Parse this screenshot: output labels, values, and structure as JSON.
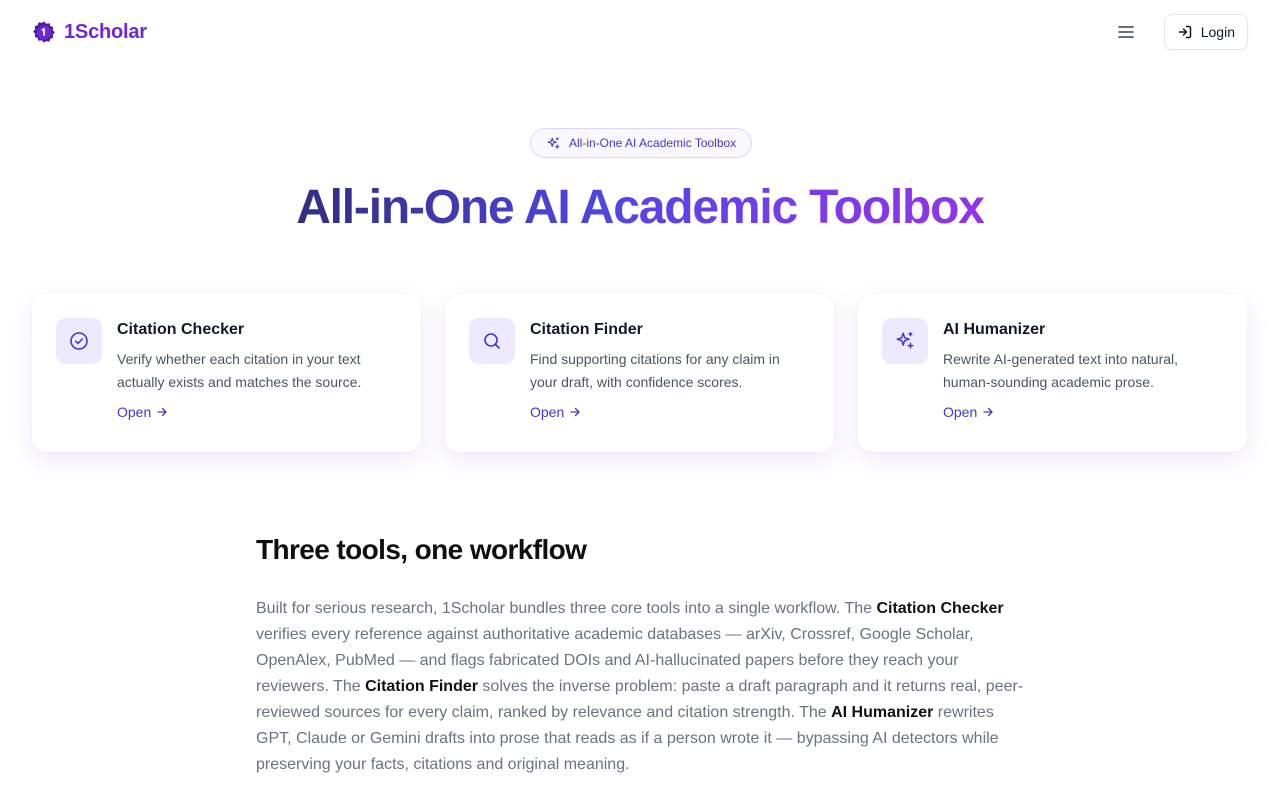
{
  "brand": {
    "name": "1Scholar",
    "logo_icon": "badge-one-icon",
    "accent": "#6d28d9"
  },
  "header": {
    "menu_icon": "hamburger-menu-icon",
    "login_label": "Login",
    "login_icon": "login-arrow-icon"
  },
  "hero": {
    "badge_label": "All-in-One AI Academic Toolbox",
    "badge_icon": "sparkles-icon",
    "title": "All-in-One AI Academic Toolbox"
  },
  "cards": [
    {
      "icon": "check-circle-icon",
      "title": "Citation Checker",
      "description": "Verify whether each citation in your text actually exists and matches the source.",
      "link_label": "Open"
    },
    {
      "icon": "search-icon",
      "title": "Citation Finder",
      "description": "Find supporting citations for any claim in your draft, with confidence scores.",
      "link_label": "Open"
    },
    {
      "icon": "sparkles-icon",
      "title": "AI Humanizer",
      "description": "Rewrite AI-generated text into natural, human-sounding academic prose.",
      "link_label": "Open"
    }
  ],
  "section": {
    "title": "Three tools, one workflow",
    "p1": "Built for serious research, 1Scholar bundles three core tools into a single workflow. The ",
    "b1": "Citation Checker",
    "p2": " verifies every reference against authoritative academic databases — arXiv, Crossref, Google Scholar, OpenAlex, PubMed — and flags fabricated DOIs and AI-hallucinated papers before they reach your reviewers. The ",
    "b2": "Citation Finder",
    "p3": " solves the inverse problem: paste a draft paragraph and it returns real, peer-reviewed sources for every claim, ranked by relevance and citation strength. The ",
    "b3": "AI Humanizer",
    "p4": " rewrites GPT, Claude or Gemini drafts into prose that reads as if a person wrote it — bypassing AI detectors while preserving your facts, citations and original meaning."
  }
}
